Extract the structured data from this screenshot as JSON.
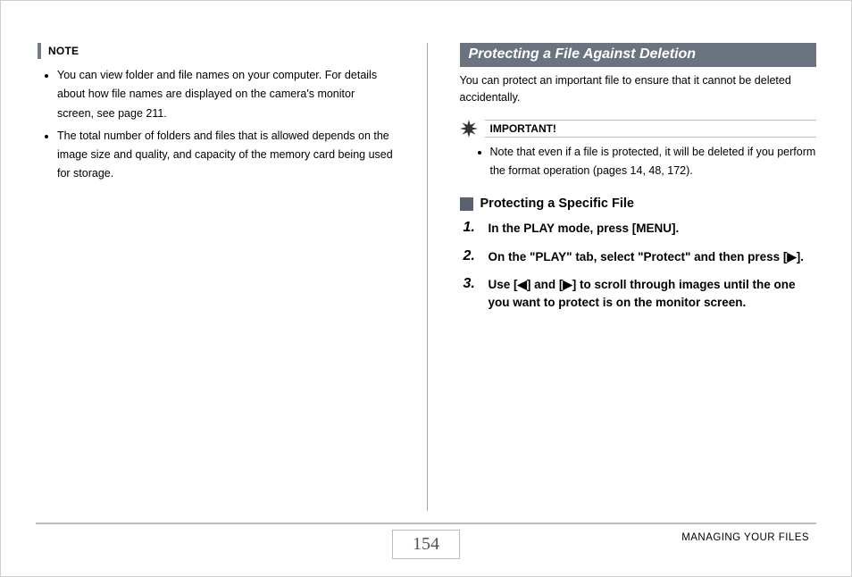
{
  "left": {
    "note_label": "NOTE",
    "bullets": [
      "You can view folder and file names on your computer. For details about how file names are displayed on the camera's monitor screen, see page 211.",
      "The total number of folders and files that is allowed depends on the image size and quality, and capacity of the memory card being used for storage."
    ]
  },
  "right": {
    "section_title": "Protecting a File Against Deletion",
    "intro": "You can protect an important file to ensure that it cannot be deleted accidentally.",
    "important_label": "IMPORTANT!",
    "important_bullets": [
      "Note that even if a file is protected, it will be deleted if you perform the format operation (pages 14, 48, 172)."
    ],
    "subsection_title": "Protecting a Specific File",
    "steps": [
      {
        "num": "1.",
        "text": "In the PLAY mode, press [MENU]."
      },
      {
        "num": "2.",
        "text": "On the \"PLAY\" tab, select \"Protect\" and then press [▶]."
      },
      {
        "num": "3.",
        "text": "Use [◀] and [▶] to scroll through images until the one you want to protect is on the monitor screen."
      }
    ]
  },
  "footer": {
    "page_number": "154",
    "section": "MANAGING YOUR FILES"
  }
}
